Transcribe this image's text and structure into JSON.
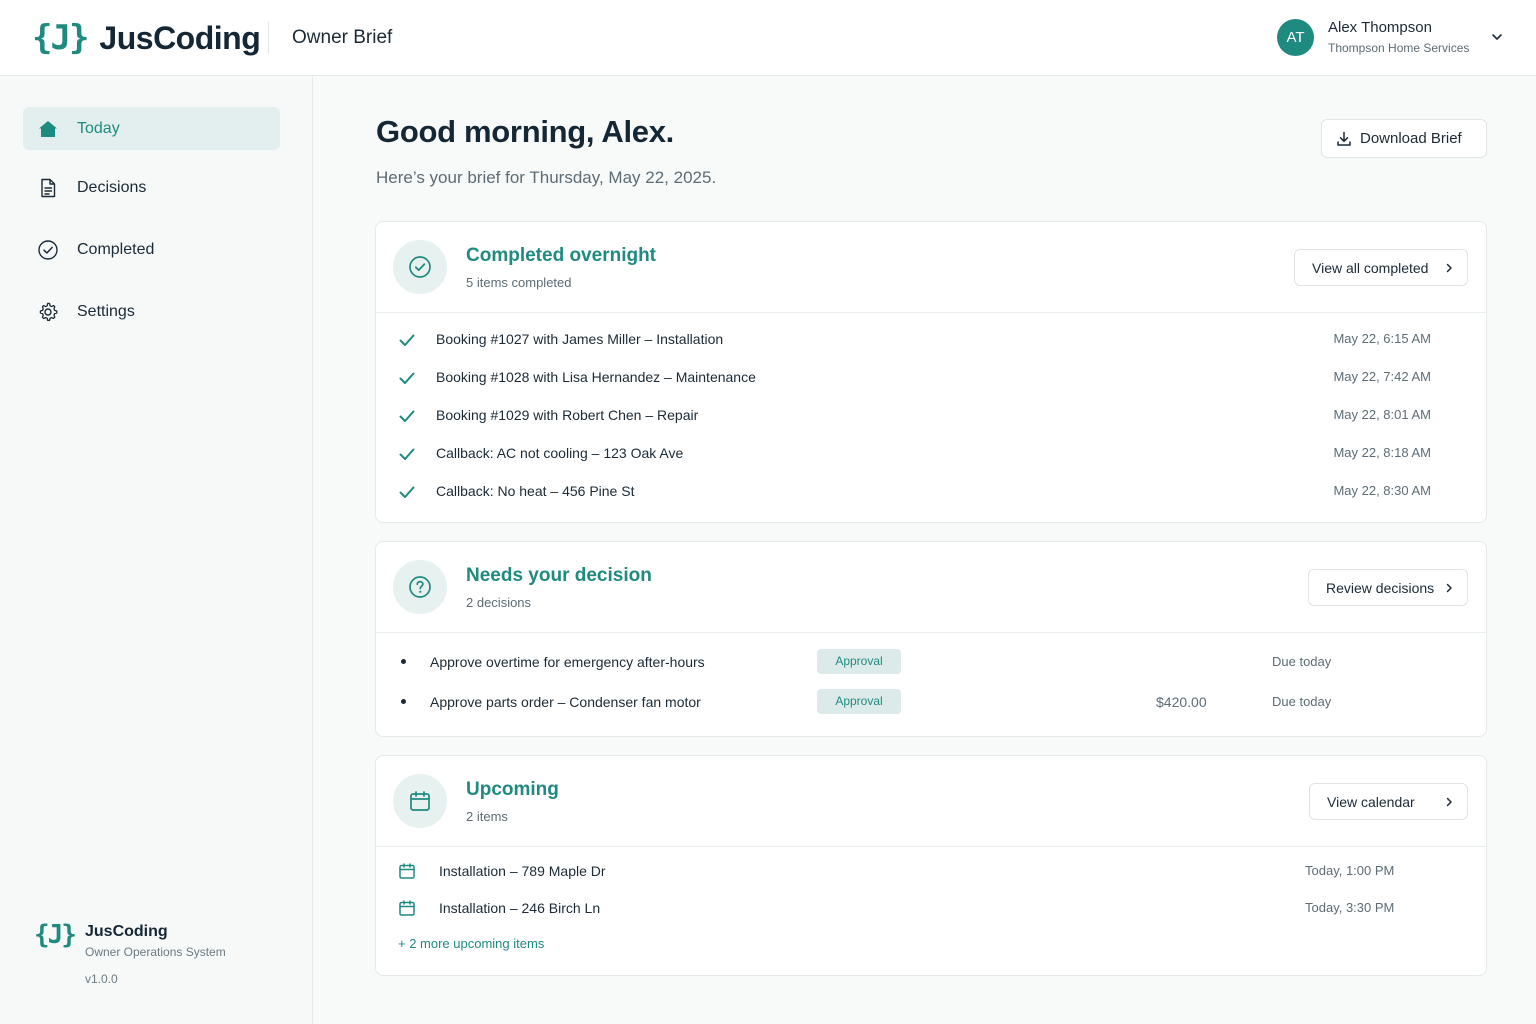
{
  "app": {
    "logo_mark": "{J}",
    "logo_text": "JusCoding",
    "page_title": "Owner Brief"
  },
  "user": {
    "initials": "AT",
    "name": "Alex Thompson",
    "company": "Thompson Home Services",
    "menu_icon": "chevron-down-icon"
  },
  "sidebar": {
    "items": [
      {
        "label": "Today",
        "icon": "home-icon",
        "active": true
      },
      {
        "label": "Decisions",
        "icon": "document-icon",
        "active": false
      },
      {
        "label": "Completed",
        "icon": "check-circle-icon",
        "active": false
      },
      {
        "label": "Settings",
        "icon": "gear-icon",
        "active": false
      }
    ],
    "footer": {
      "mark": "{J}",
      "name": "JusCoding",
      "subtitle": "Owner Operations System",
      "version": "v1.0.0"
    }
  },
  "main": {
    "greeting": "Good morning, Alex.",
    "subtitle": "Here’s your brief for Thursday, May 22, 2025.",
    "download_label": "Download Brief"
  },
  "completed": {
    "title": "Completed overnight",
    "subtitle": "5 items completed",
    "button_label": "View all completed",
    "items": [
      {
        "text": "Booking #1027 with James Miller – Installation",
        "time": "May 22, 6:15 AM"
      },
      {
        "text": "Booking #1028 with Lisa Hernandez – Maintenance",
        "time": "May 22, 7:42 AM"
      },
      {
        "text": "Booking #1029 with Robert Chen – Repair",
        "time": "May 22, 8:01 AM"
      },
      {
        "text": "Callback: AC not cooling – 123 Oak Ave",
        "time": "May 22, 8:18 AM"
      },
      {
        "text": "Callback: No heat – 456 Pine St",
        "time": "May 22, 8:30 AM"
      }
    ]
  },
  "decisions": {
    "title": "Needs your decision",
    "subtitle": "2 decisions",
    "button_label": "Review decisions",
    "items": [
      {
        "text": "Approve overtime for emergency after-hours",
        "badge": "Approval",
        "amount": "",
        "due": "Due today"
      },
      {
        "text": "Approve parts order – Condenser fan motor",
        "badge": "Approval",
        "amount": "$420.00",
        "due": "Due today"
      }
    ]
  },
  "upcoming": {
    "title": "Upcoming",
    "subtitle": "2 items",
    "button_label": "View calendar",
    "items": [
      {
        "text": "Installation – 789 Maple Dr",
        "time": "Today, 1:00 PM"
      },
      {
        "text": "Installation – 246 Birch Ln",
        "time": "Today, 3:30 PM"
      }
    ],
    "more_label": "+ 2 more upcoming items"
  },
  "colors": {
    "accent": "#1f8a80",
    "accent_light": "#e3efee",
    "text": "#1b2a36",
    "muted": "#5d6c75"
  }
}
